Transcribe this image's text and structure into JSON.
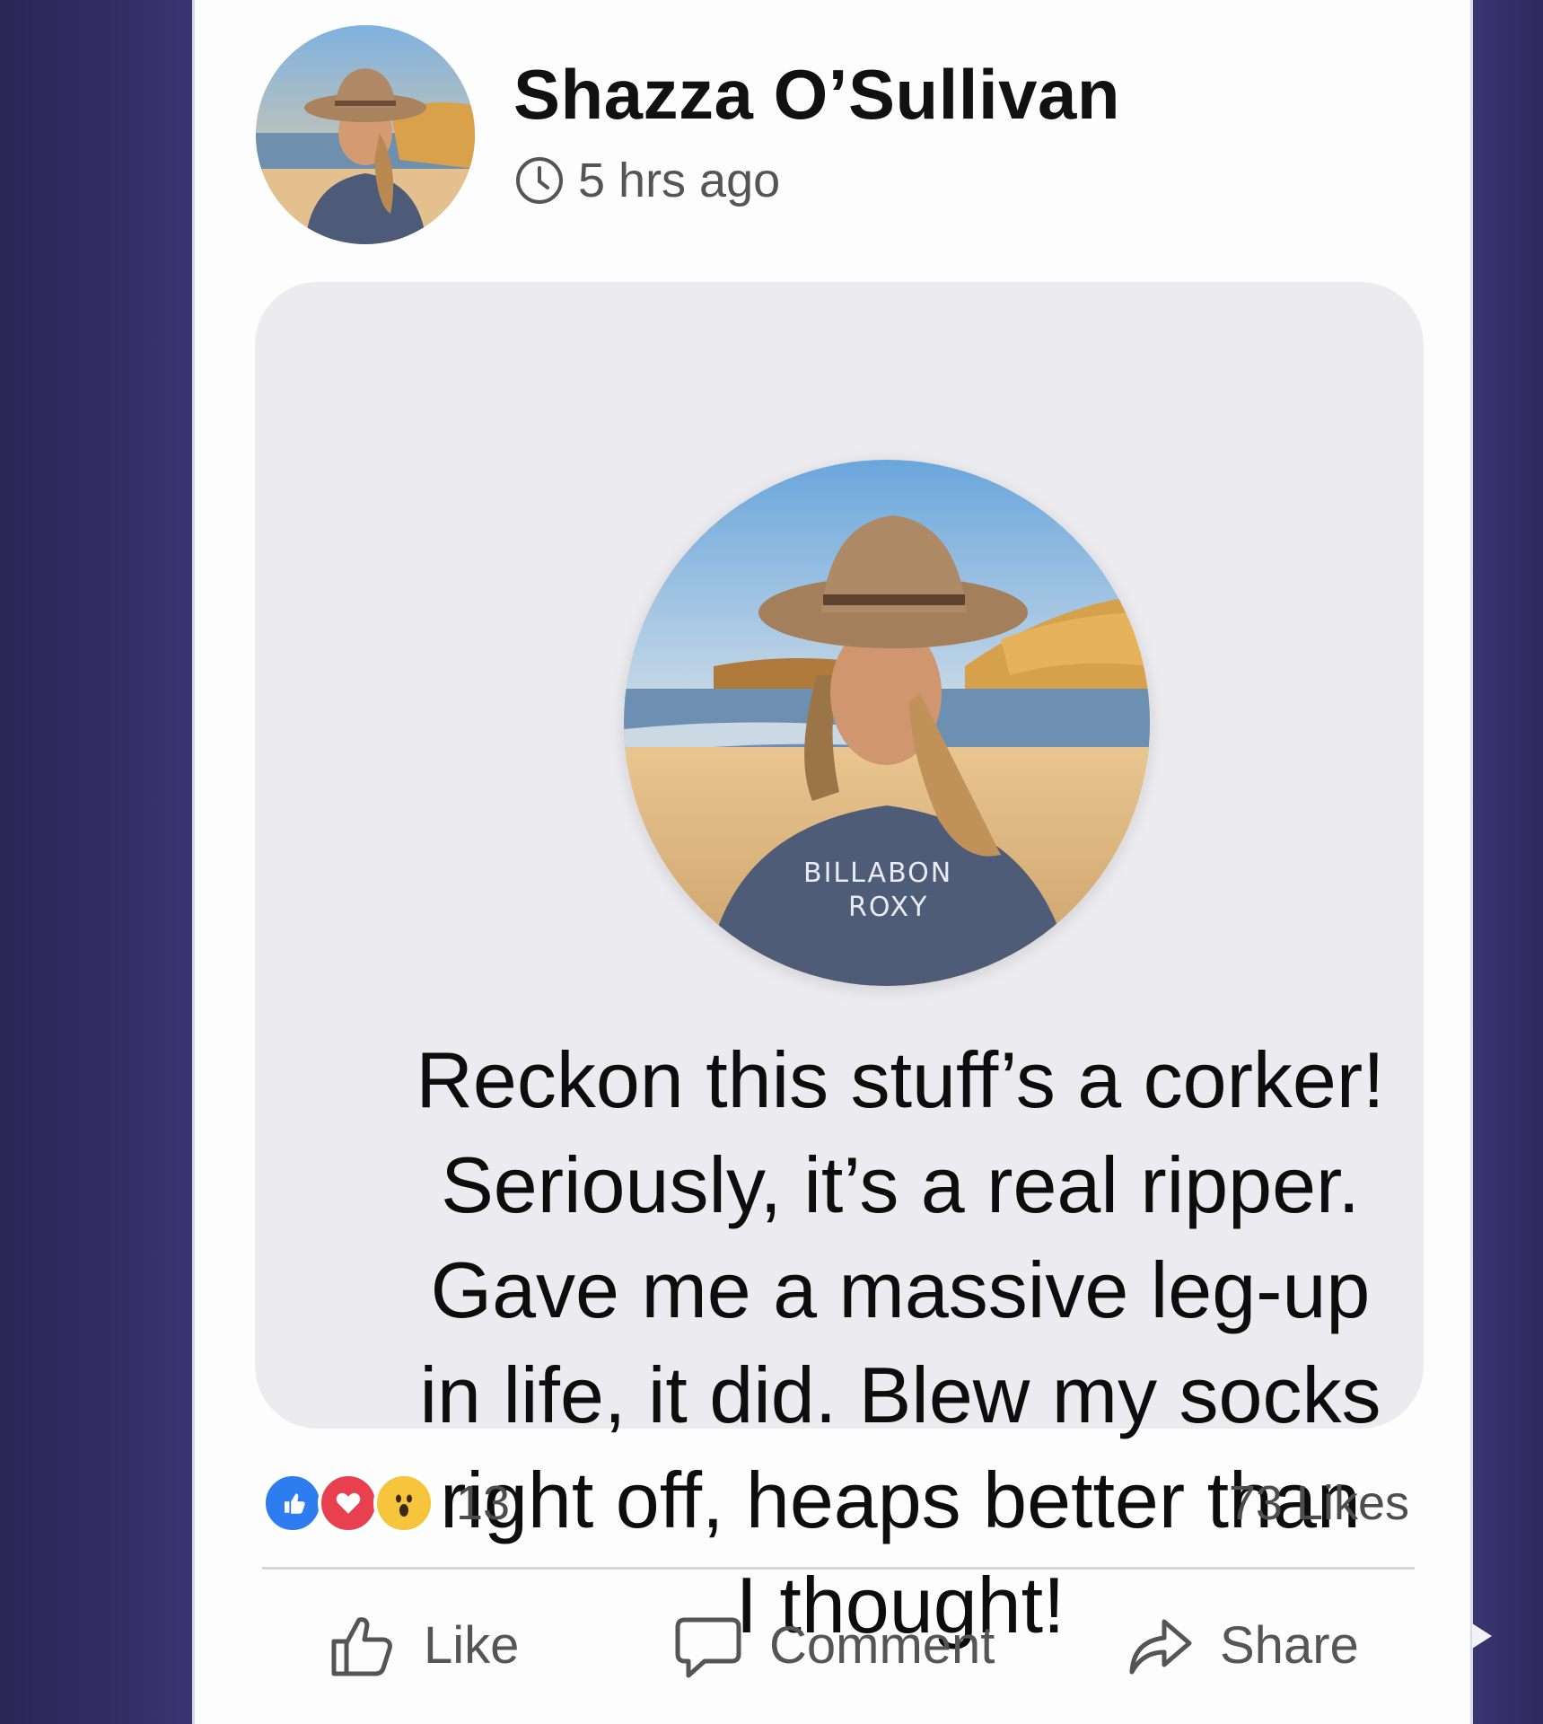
{
  "post": {
    "author_name": "Shazza O’Sullivan",
    "timestamp": "5 hrs ago",
    "body_lines": [
      "Reckon this stuff’s a corker!",
      "Seriously, it’s a real ripper.",
      "Gave me a massive leg-up",
      "in life, it did. Blew my socks",
      "right off, heaps better than",
      "I thought!"
    ],
    "photo_shirt_text": [
      "BILLABON",
      "ROXY"
    ]
  },
  "reactions": {
    "icons": [
      "like-reaction-icon",
      "love-reaction-icon",
      "wow-reaction-icon"
    ],
    "count": "13",
    "likes_label": "73 Likes"
  },
  "actions": {
    "like_label": "Like",
    "comment_label": "Comment",
    "share_label": "Share"
  },
  "colors": {
    "background": "#2f2a5e",
    "card": "#fdfdfe",
    "bubble": "#ececf0",
    "like_blue": "#2d7cf0",
    "love_red": "#e8404f",
    "wow_yellow": "#f6c53b"
  }
}
